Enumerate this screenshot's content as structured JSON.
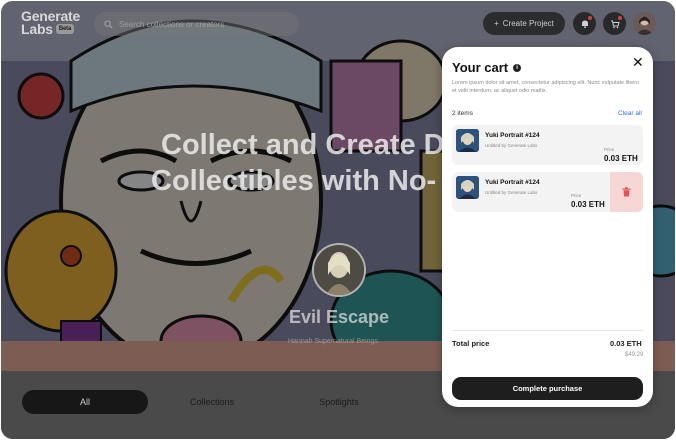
{
  "header": {
    "logo_line1": "Generate",
    "logo_line2": "Labs",
    "logo_badge": "Beta",
    "search_placeholder": "Search collections or creators",
    "create_label": "Create Project",
    "icons": [
      "search-icon",
      "plus-icon",
      "bell-icon",
      "cart-icon",
      "avatar"
    ]
  },
  "hero": {
    "title_line1": "Collect and Create D",
    "title_line2": "Collectibles with No-",
    "collection_name": "Evil Escape",
    "collection_by": "Hannah Supernatural Beings"
  },
  "tabs": [
    {
      "label": "All",
      "active": true
    },
    {
      "label": "Collections",
      "active": false
    },
    {
      "label": "Spotlights",
      "active": false
    }
  ],
  "cart": {
    "title": "Your cart",
    "description": "Lorem ipsum dolor sit amet, consectetur adipiscing elit. Nunc vulputate libero et velit interdum, ac aliquet odio mattis.",
    "item_count": "2 items",
    "clear_label": "Clear all",
    "items": [
      {
        "name": "Yuki Portrait #124",
        "creator": "Untitled by Generate Labs",
        "price_label": "Price",
        "price": "0.03 ETH",
        "show_delete": false
      },
      {
        "name": "Yuki Portrait #124",
        "creator": "Untitled by Generate Labs",
        "price_label": "Price",
        "price": "0.03 ETH",
        "show_delete": true
      }
    ],
    "total_label": "Total price",
    "total_eth": "0.03 ETH",
    "total_usd": "$49.29",
    "purchase_label": "Complete purchase"
  },
  "colors": {
    "accent_link": "#2f6fe0",
    "delete_bg": "#f7d6d6",
    "delete_icon": "#e05555",
    "button_dark": "#1e1e1e"
  }
}
